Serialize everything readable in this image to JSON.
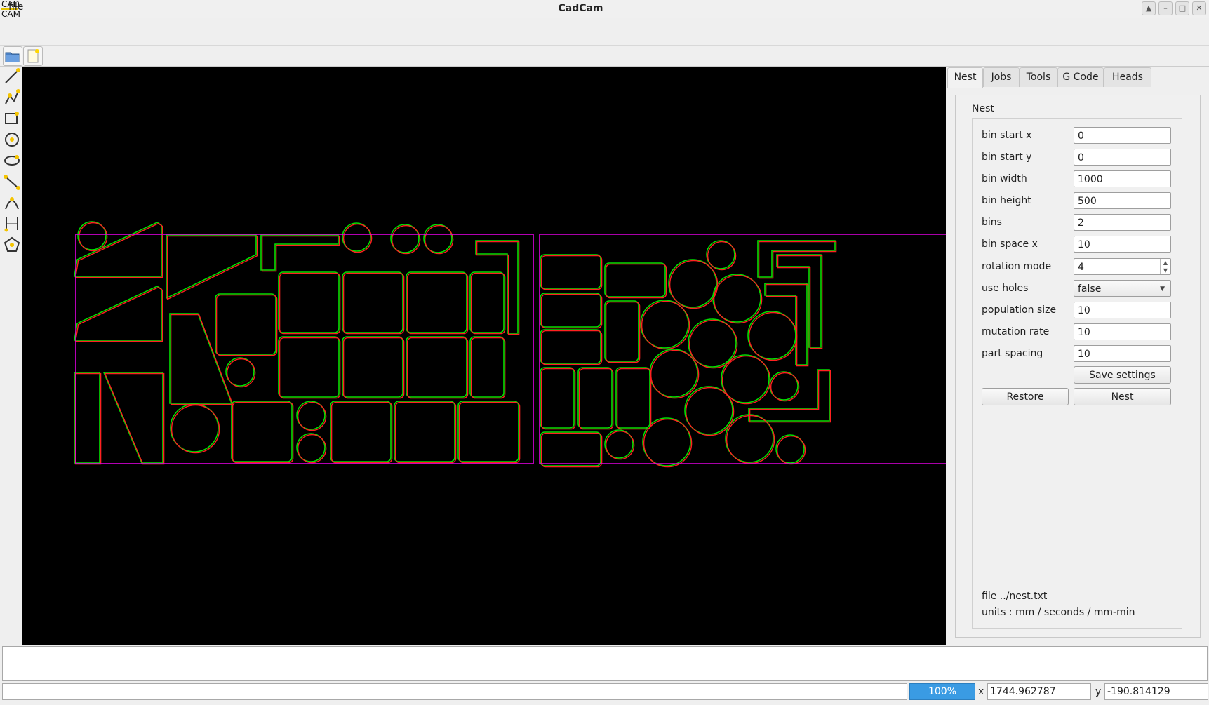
{
  "window": {
    "title": "CadCam",
    "logo_line1": "CAD",
    "logo_line2": "CAM"
  },
  "menu": {
    "file": "file"
  },
  "toolbar": {
    "icons": [
      "open-folder-icon",
      "new-file-icon"
    ]
  },
  "sidebar": {
    "tools": [
      "line-tool-icon",
      "polyline-tool-icon",
      "rectangle-tool-icon",
      "circle-tool-icon",
      "ellipse-tool-icon",
      "path-tool-icon",
      "arc-tool-icon",
      "dimension-tool-icon",
      "polygon-tool-icon"
    ]
  },
  "tabs": [
    "Nest",
    "Jobs",
    "Tools",
    "G Code",
    "Heads"
  ],
  "nest": {
    "group_title": "Nest",
    "fields": [
      {
        "label": "bin start x",
        "value": "0"
      },
      {
        "label": "bin start y",
        "value": "0"
      },
      {
        "label": "bin width",
        "value": "1000"
      },
      {
        "label": "bin height",
        "value": "500"
      },
      {
        "label": "bins",
        "value": "2"
      },
      {
        "label": "bin space x",
        "value": "10"
      },
      {
        "label": "rotation mode",
        "value": "4"
      },
      {
        "label": "use holes",
        "value": "false"
      },
      {
        "label": "population size",
        "value": "10"
      },
      {
        "label": "mutation rate",
        "value": "10"
      },
      {
        "label": "part spacing",
        "value": "10"
      }
    ],
    "save_settings": "Save settings",
    "restore": "Restore",
    "nest_button": "Nest",
    "file": "file ../nest.txt",
    "units": "units : mm / seconds / mm-min"
  },
  "status": {
    "zoom": "100%",
    "x_label": "x",
    "x_value": "1744.962787",
    "y_label": "y",
    "y_value": "-190.814129"
  },
  "colors": {
    "bin_outline": "#e000e0",
    "part_outer": "#00e000",
    "part_inner": "#ff2020",
    "canvas": "#000000",
    "zoom_button": "#3a9be3"
  }
}
